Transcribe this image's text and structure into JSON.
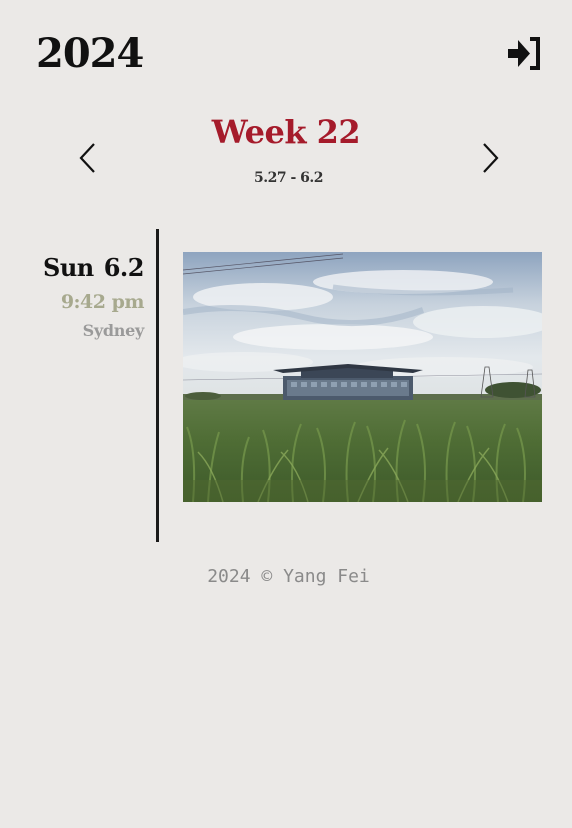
{
  "header": {
    "year": "2024",
    "login_icon": "sign-in-icon"
  },
  "week_nav": {
    "title": "Week 22",
    "range": "5.27 - 6.2",
    "prev_icon": "chevron-left-icon",
    "next_icon": "chevron-right-icon"
  },
  "entries": [
    {
      "weekday": "Sun",
      "date": "6.2",
      "time": "9:42 pm",
      "location": "Sydney",
      "photo_icon": "landscape-photo"
    }
  ],
  "footer": {
    "text": "2024 © Yang Fei"
  },
  "colors": {
    "background": "#ebe9e7",
    "accent": "#a51b2b",
    "time": "#a7a98e",
    "location": "#9a9a9a",
    "footer": "#8a8a8a"
  }
}
